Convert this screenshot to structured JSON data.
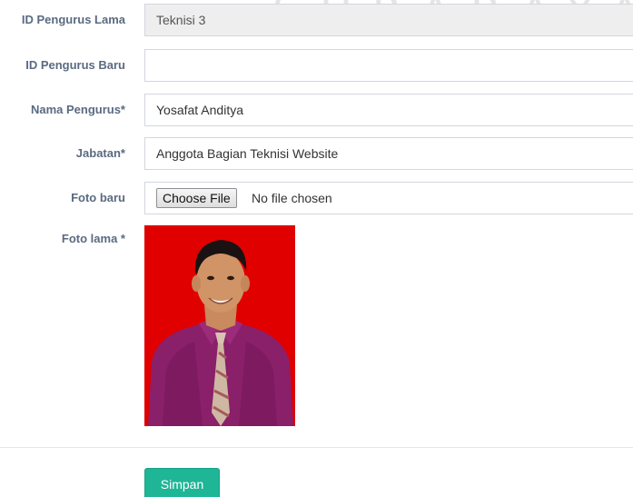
{
  "watermark": "SURABAYA",
  "form": {
    "id_lama": {
      "label": "ID Pengurus Lama",
      "value": "Teknisi 3"
    },
    "id_baru": {
      "label": "ID Pengurus Baru",
      "value": ""
    },
    "nama": {
      "label": "Nama Pengurus*",
      "value": "Yosafat Anditya"
    },
    "jabatan": {
      "label": "Jabatan*",
      "value": "Anggota Bagian Teknisi Website"
    },
    "foto_baru": {
      "label": "Foto baru",
      "button": "Choose File",
      "status": "No file chosen"
    },
    "foto_lama": {
      "label": "Foto lama *"
    }
  },
  "actions": {
    "save_label": "Simpan"
  },
  "colors": {
    "label": "#5a6a80",
    "save_button": "#1fb597",
    "photo_background": "#e00000",
    "readonly_field": "#eeeeee"
  }
}
